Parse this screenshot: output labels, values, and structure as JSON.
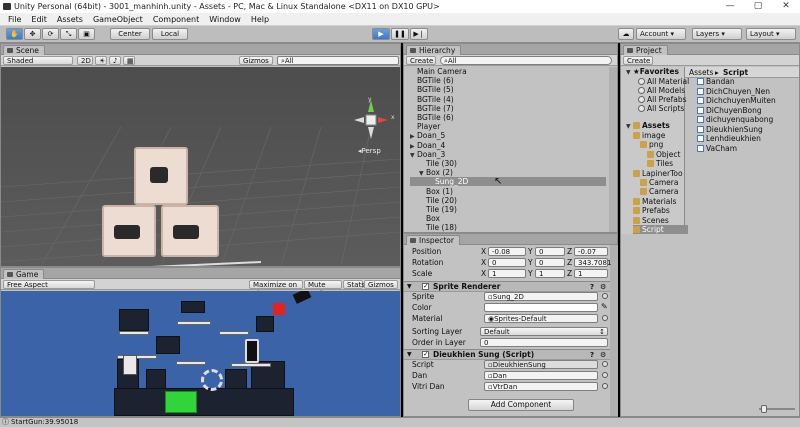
{
  "window": {
    "title": "Unity Personal (64bit) - 3001_manhinh.unity - Assets - PC, Mac & Linux Standalone <DX11 on DX10 GPU>",
    "controls": [
      "—",
      "▢",
      "✕"
    ]
  },
  "menu": [
    "File",
    "Edit",
    "Assets",
    "GameObject",
    "Component",
    "Window",
    "Help"
  ],
  "toolbar": {
    "center": "Center",
    "local": "Local",
    "play": "▶",
    "pause": "❚❚",
    "step": "▶❘",
    "account": "Account",
    "layers": "Layers",
    "layout": "Layout",
    "cloud": "☁"
  },
  "scene": {
    "tab": "Scene",
    "shading": "Shaded",
    "mode2d": "2D",
    "gizmos": "Gizmos",
    "search": "All",
    "persp": "Persp",
    "gizmo_y": "y",
    "gizmo_x": "x"
  },
  "game": {
    "tab": "Game",
    "aspect": "Free Aspect",
    "buttons": [
      "Maximize on Play",
      "Mute audio",
      "Stats",
      "Gizmos"
    ]
  },
  "hierarchy": {
    "tab": "Hierarchy",
    "create": "Create",
    "search": "All",
    "rows": [
      {
        "label": "Main Camera",
        "indent": 0,
        "arrow": ""
      },
      {
        "label": "BGTile (6)",
        "indent": 0,
        "arrow": ""
      },
      {
        "label": "BGTile (5)",
        "indent": 0,
        "arrow": ""
      },
      {
        "label": "BGTile (4)",
        "indent": 0,
        "arrow": ""
      },
      {
        "label": "BGTile (7)",
        "indent": 0,
        "arrow": ""
      },
      {
        "label": "BGTile (6)",
        "indent": 0,
        "arrow": ""
      },
      {
        "label": "Player",
        "indent": 0,
        "arrow": ""
      },
      {
        "label": "Doan_5",
        "indent": 0,
        "arrow": "▶"
      },
      {
        "label": "Doan_4",
        "indent": 0,
        "arrow": "▶"
      },
      {
        "label": "Doan_3",
        "indent": 0,
        "arrow": "▼"
      },
      {
        "label": "Tile (30)",
        "indent": 1,
        "arrow": ""
      },
      {
        "label": "Box (2)",
        "indent": 1,
        "arrow": "▼"
      },
      {
        "label": "Sung_2D",
        "indent": 2,
        "arrow": "",
        "selected": true
      },
      {
        "label": "Box (1)",
        "indent": 1,
        "arrow": ""
      },
      {
        "label": "Tile (20)",
        "indent": 1,
        "arrow": ""
      },
      {
        "label": "Tile (19)",
        "indent": 1,
        "arrow": ""
      },
      {
        "label": "Box",
        "indent": 1,
        "arrow": ""
      },
      {
        "label": "Tile (18)",
        "indent": 1,
        "arrow": ""
      }
    ]
  },
  "project": {
    "tab": "Project",
    "create": "Create",
    "favorites": {
      "label": "Favorites",
      "items": [
        "All Material",
        "All Models",
        "All Prefabs",
        "All Scripts"
      ]
    },
    "assets": {
      "label": "Assets",
      "items": [
        {
          "label": "image",
          "indent": 1
        },
        {
          "label": "png",
          "indent": 2
        },
        {
          "label": "Object",
          "indent": 3
        },
        {
          "label": "Tiles",
          "indent": 3
        },
        {
          "label": "LapinerToo",
          "indent": 1
        },
        {
          "label": "Camera",
          "indent": 2
        },
        {
          "label": "Camera",
          "indent": 2
        },
        {
          "label": "Materials",
          "indent": 1
        },
        {
          "label": "Prefabs",
          "indent": 1
        },
        {
          "label": "Scenes",
          "indent": 1
        },
        {
          "label": "Script",
          "indent": 1,
          "selected": true
        }
      ]
    },
    "breadcrumb": [
      "Assets",
      "Script"
    ],
    "scripts": [
      "Bandan",
      "DichChuyen_Nen",
      "DichchuyenMuiten",
      "DiChuyenBong",
      "dichuyenquabong",
      "DieukhienSung",
      "Lenhdieukhien",
      "VaCham"
    ]
  },
  "inspector": {
    "tab": "Inspector",
    "transform": {
      "position_label": "Position",
      "rotation_label": "Rotation",
      "scale_label": "Scale",
      "position": {
        "x": "-0.08",
        "y": "0",
        "z": "-0.07"
      },
      "rotation": {
        "x": "0",
        "y": "0",
        "z": "343.7081"
      },
      "scale": {
        "x": "1",
        "y": "1",
        "z": "1"
      },
      "axis_x": "X",
      "axis_y": "Y",
      "axis_z": "Z"
    },
    "sprite_renderer": {
      "title": "Sprite Renderer",
      "sprite_label": "Sprite",
      "sprite": "Sung_2D",
      "color_label": "Color",
      "material_label": "Material",
      "material": "Sprites-Default",
      "sorting_layer_label": "Sorting Layer",
      "sorting_layer": "Default",
      "order_label": "Order in Layer",
      "order": "0"
    },
    "script_component": {
      "title": "Dieukhien Sung (Script)",
      "script_label": "Script",
      "script": "DieukhienSung",
      "dan_label": "Dan",
      "dan": "Dan",
      "vitri_label": "Vitri Dan",
      "vitri": "VtrDan"
    },
    "add_component": "Add Component"
  },
  "status": {
    "text": "StartGun:39.95018"
  },
  "colors": {
    "editor_bg": "#c2c2c2",
    "scene_bg": "#505050",
    "game_bg": "#3a63a8",
    "play_blue": "#3d79c9",
    "selected_row": "#8e8e8e"
  }
}
